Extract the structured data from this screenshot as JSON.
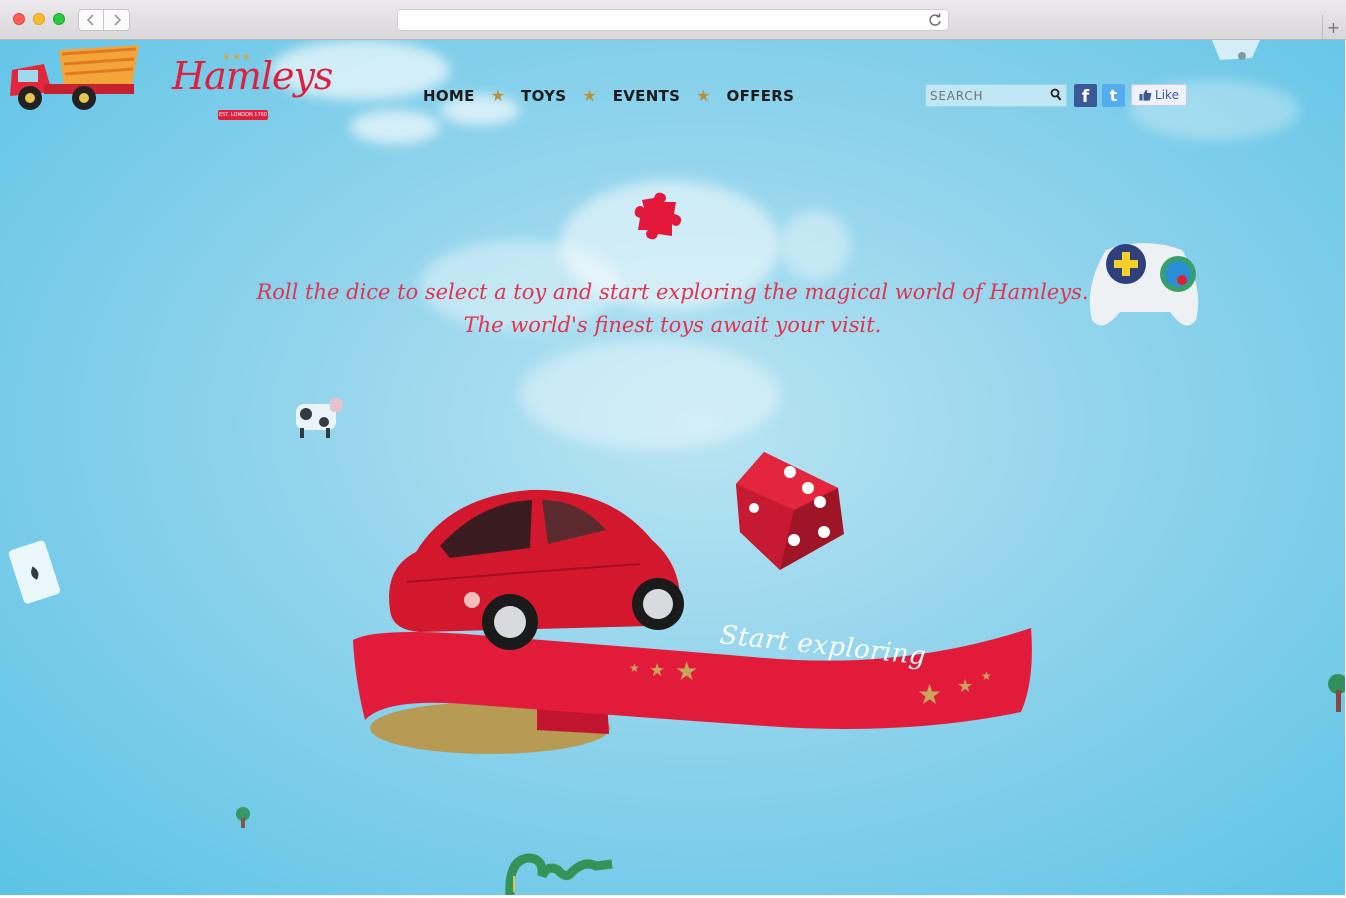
{
  "browser": {
    "url": "",
    "new_tab_label": "+"
  },
  "header": {
    "logo_text": "Hamleys",
    "logo_ribbon": "EST. LONDON 1760",
    "nav": [
      {
        "label": "HOME"
      },
      {
        "label": "TOYS"
      },
      {
        "label": "EVENTS"
      },
      {
        "label": "OFFERS"
      }
    ],
    "search_placeholder": "SEARCH",
    "like_label": "Like"
  },
  "hero": {
    "tagline_line1": "Roll the dice to select a toy and start exploring the magical world of Hamleys.",
    "tagline_line2": "The world's finest toys await your visit.",
    "cta_label": "Start exploring"
  },
  "colors": {
    "brand_red": "#e01f3d",
    "sky": "#8fd3ec",
    "gold_star": "#b8933f"
  },
  "icons": [
    "search-icon",
    "facebook-icon",
    "twitter-icon",
    "like-thumb-icon",
    "reload-icon",
    "back-arrow-icon",
    "forward-arrow-icon"
  ]
}
